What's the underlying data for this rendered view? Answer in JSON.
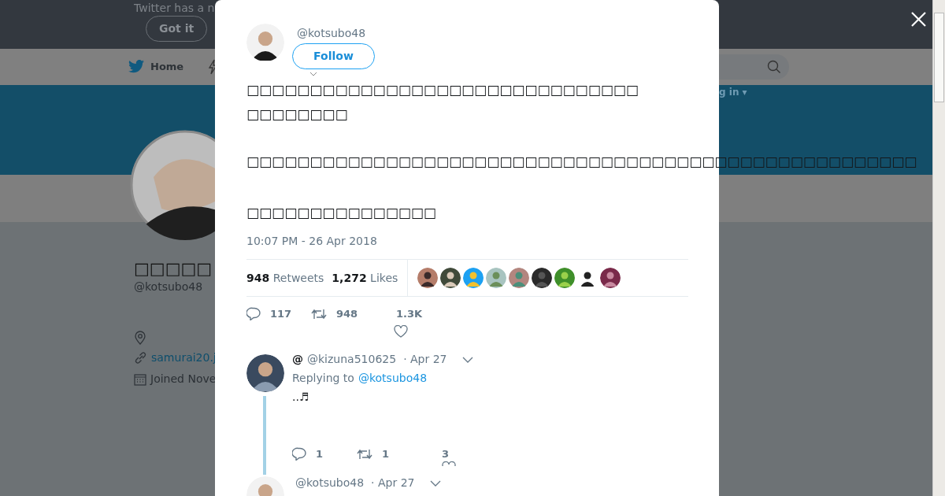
{
  "notice": {
    "text": "Twitter has a n",
    "button": "Got it"
  },
  "nav": {
    "home": "Home",
    "login": "g in ▾"
  },
  "profile": {
    "name": "□□□□□",
    "handle": "@kotsubo48",
    "link": "samurai20.j",
    "joined": "Joined Nove"
  },
  "tweet": {
    "handle": "@kotsubo48",
    "follow": "Follow",
    "paragraphs": [
      "□□□□□□□□□□□□□□□□□□□□□□□□□□□□□□□□□□□□□□□",
      "□□□□□□□□□□□□□□□□□□□□□□□□□□□□□□□□□□□□□□□□□□□□□□□□□□□□□",
      "□□□□□□□□□□□□□□□"
    ],
    "time": "10:07 PM - 26 Apr 2018",
    "stats": [
      {
        "count": "948",
        "label": "Retweets"
      },
      {
        "count": "1,272",
        "label": "Likes"
      }
    ],
    "actions": [
      {
        "kind": "reply",
        "count": "117"
      },
      {
        "kind": "retweet",
        "count": "948"
      },
      {
        "kind": "like",
        "count": "1.3K"
      }
    ]
  },
  "replies": [
    {
      "name": "@",
      "handle": "@kizuna510625",
      "date": "· Apr 27",
      "replying_label": "Replying to",
      "replying_to": "@kotsubo48",
      "text": "..♬",
      "actions": [
        {
          "kind": "reply",
          "count": "1"
        },
        {
          "kind": "retweet",
          "count": "1"
        },
        {
          "kind": "like",
          "count": "3"
        }
      ]
    },
    {
      "handle": "@kotsubo48",
      "date": "· Apr 27"
    }
  ]
}
